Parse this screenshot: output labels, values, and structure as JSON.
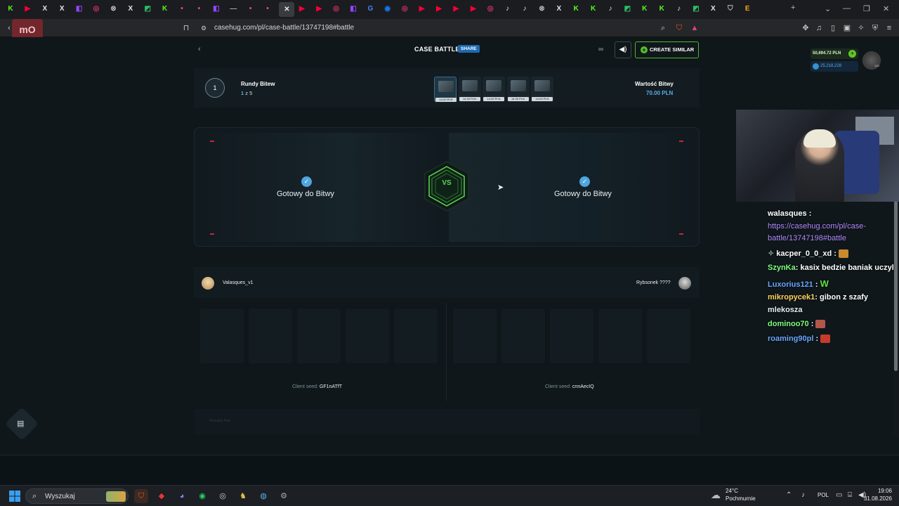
{
  "browser": {
    "url": "casehug.com/pl/case-battle/13747198#battle",
    "tabs": [
      {
        "glyph": "K",
        "color": "#53fc18"
      },
      {
        "glyph": "▶",
        "color": "#ff0033"
      },
      {
        "glyph": "X",
        "color": "#e7e7e7"
      },
      {
        "glyph": "X",
        "color": "#e7e7e7"
      },
      {
        "glyph": "◧",
        "color": "#9146ff"
      },
      {
        "glyph": "◎",
        "color": "#e1306c"
      },
      {
        "glyph": "⊗",
        "color": "#bdbdbd"
      },
      {
        "glyph": "X",
        "color": "#e7e7e7"
      },
      {
        "glyph": "◩",
        "color": "#2dbf6b"
      },
      {
        "glyph": "K",
        "color": "#53fc18"
      },
      {
        "glyph": "•",
        "color": "#ff4d6d"
      },
      {
        "glyph": "•",
        "color": "#ff4d6d"
      },
      {
        "glyph": "◧",
        "color": "#9146ff"
      },
      {
        "glyph": "—",
        "color": "#aaaaaa"
      },
      {
        "glyph": "•",
        "color": "#ff4d6d"
      },
      {
        "glyph": "•",
        "color": "#ff4d6d"
      },
      {
        "glyph": "✕",
        "color": "#e7e7e7",
        "active": true
      },
      {
        "glyph": "▶",
        "color": "#ff0033"
      },
      {
        "glyph": "▶",
        "color": "#ff0033"
      },
      {
        "glyph": "◎",
        "color": "#e1306c"
      },
      {
        "glyph": "◧",
        "color": "#9146ff"
      },
      {
        "glyph": "G",
        "color": "#4285f4"
      },
      {
        "glyph": "◉",
        "color": "#1877f2"
      },
      {
        "glyph": "◎",
        "color": "#e1306c"
      },
      {
        "glyph": "▶",
        "color": "#ff0033"
      },
      {
        "glyph": "▶",
        "color": "#ff0033"
      },
      {
        "glyph": "▶",
        "color": "#ff0033"
      },
      {
        "glyph": "▶",
        "color": "#ff0033"
      },
      {
        "glyph": "◎",
        "color": "#e1306c"
      },
      {
        "glyph": "♪",
        "color": "#e7e7e7"
      },
      {
        "glyph": "♪",
        "color": "#e7e7e7"
      },
      {
        "glyph": "⊗",
        "color": "#bdbdbd"
      },
      {
        "glyph": "X",
        "color": "#e7e7e7"
      },
      {
        "glyph": "K",
        "color": "#53fc18"
      },
      {
        "glyph": "K",
        "color": "#53fc18"
      },
      {
        "glyph": "♪",
        "color": "#e7e7e7"
      },
      {
        "glyph": "◩",
        "color": "#2dbf6b"
      },
      {
        "glyph": "K",
        "color": "#53fc18"
      },
      {
        "glyph": "K",
        "color": "#53fc18"
      },
      {
        "glyph": "♪",
        "color": "#e7e7e7"
      },
      {
        "glyph": "◩",
        "color": "#2dbf6b"
      },
      {
        "glyph": "X",
        "color": "#e7e7e7"
      },
      {
        "glyph": "⛉",
        "color": "#bdbdbd"
      },
      {
        "glyph": "E",
        "color": "#f5a623"
      }
    ]
  },
  "header": {
    "title": "CASE BATTLE",
    "share": "SHARE",
    "create_similar": "CREATE SIMILAR"
  },
  "rounds": {
    "label": "Rundy Bitew",
    "current": "1",
    "progress_current": "1",
    "progress_total": "z 5",
    "case_price": "14.00 PLN",
    "case_count": 5,
    "value_label": "Wartość Bitwy",
    "value_amount": "70.00 PLN"
  },
  "arena": {
    "left_status": "Gotowy do Bitwy",
    "right_status": "Gotowy do Bitwy",
    "vs": "VS"
  },
  "players": {
    "left_name": "Valasques_v1",
    "right_name": "Rybsonek ????"
  },
  "seeds": {
    "left_label": "Client seed:",
    "left_value": "GF1nATfT",
    "right_label": "Client seed:",
    "right_value": "cnnAecIQ"
  },
  "fair": {
    "text": "Provably Fair"
  },
  "wallet": {
    "pln": "50,694.72 PLN",
    "coins": "25,218,228",
    "level": "120"
  },
  "chat": [
    {
      "name": "walasques",
      "name_color": "#ffffff",
      "message": ":"
    },
    {
      "name": "",
      "name_color": "#b38cff",
      "message": "https://casehug.com/pl/case-"
    },
    {
      "name": "",
      "name_color": "#b38cff",
      "message": "battle/13747198#battle"
    },
    {
      "name": "kacper_0_0_xd",
      "name_color": "#ffffff",
      "message": ":"
    },
    {
      "name": "SzynKa",
      "name_color": "#7fff7f",
      "message": ": kasix bedzie baniak uczyl"
    },
    {
      "name": "Luxorius121",
      "name_color": "#6aa6ff",
      "message": ":"
    },
    {
      "name": "mikropycek1",
      "name_color": "#ffd35a",
      "message": ": gibon z szafy"
    },
    {
      "name": "",
      "name_color": "#ffffff",
      "message": "mlekosza"
    },
    {
      "name": "dominoo70",
      "name_color": "#7fff7f",
      "message": ":"
    },
    {
      "name": "roaming90pl",
      "name_color": "#6aa6ff",
      "message": ":"
    }
  ],
  "taskbar": {
    "search_placeholder": "Wyszukaj",
    "weather_temp": "24°C",
    "weather_desc": "Pochmurnie",
    "lang": "POL",
    "time": "19:06",
    "date": "31.08.2026"
  }
}
